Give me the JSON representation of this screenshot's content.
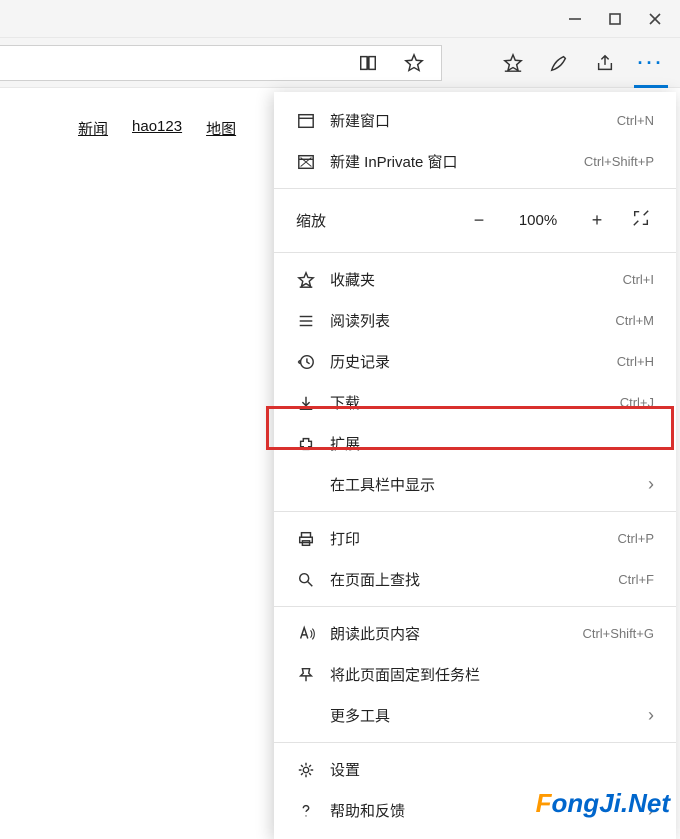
{
  "nav": {
    "news": "新闻",
    "hao123": "hao123",
    "map": "地图"
  },
  "zoom": {
    "label": "缩放",
    "value": "100%"
  },
  "menu": {
    "new_window": {
      "label": "新建窗口",
      "shortcut": "Ctrl+N"
    },
    "new_inprivate": {
      "label": "新建 InPrivate 窗口",
      "shortcut": "Ctrl+Shift+P"
    },
    "favorites": {
      "label": "收藏夹",
      "shortcut": "Ctrl+I"
    },
    "reading_list": {
      "label": "阅读列表",
      "shortcut": "Ctrl+M"
    },
    "history": {
      "label": "历史记录",
      "shortcut": "Ctrl+H"
    },
    "downloads": {
      "label": "下载",
      "shortcut": "Ctrl+J"
    },
    "extensions": {
      "label": "扩展"
    },
    "show_in_toolbar": {
      "label": "在工具栏中显示"
    },
    "print": {
      "label": "打印",
      "shortcut": "Ctrl+P"
    },
    "find": {
      "label": "在页面上查找",
      "shortcut": "Ctrl+F"
    },
    "read_aloud": {
      "label": "朗读此页内容",
      "shortcut": "Ctrl+Shift+G"
    },
    "pin": {
      "label": "将此页面固定到任务栏"
    },
    "more_tools": {
      "label": "更多工具"
    },
    "settings": {
      "label": "设置"
    },
    "help": {
      "label": "帮助和反馈"
    }
  },
  "watermark": {
    "f": "F",
    "rest": "ongJi.Net"
  }
}
